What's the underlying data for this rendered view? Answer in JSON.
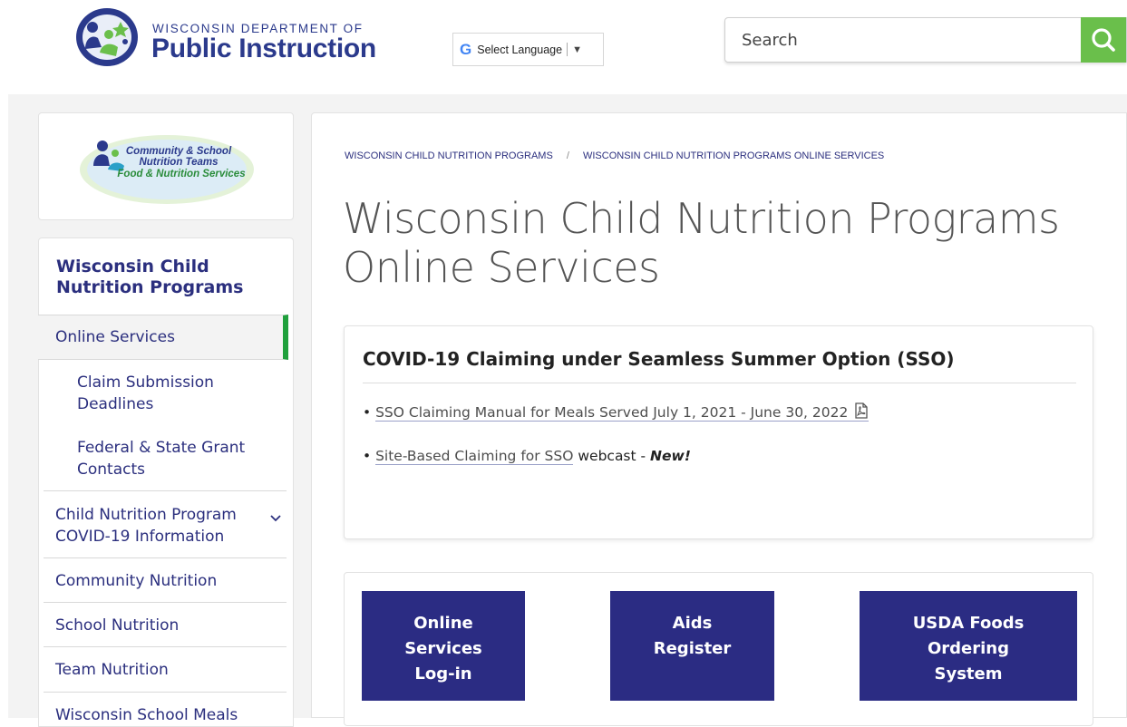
{
  "header": {
    "logo_top": "WISCONSIN DEPARTMENT OF",
    "logo_main": "Public Instruction",
    "translate_label": "Select Language",
    "search_placeholder": "Search"
  },
  "sidebar": {
    "logo_text": [
      "Community & School",
      "Nutrition Teams",
      "Food & Nutrition Services"
    ],
    "title": "Wisconsin Child Nutrition Programs",
    "items": [
      {
        "label": "Online Services"
      },
      {
        "label": "Claim Submission Deadlines"
      },
      {
        "label": "Federal & State Grant Contacts"
      },
      {
        "label": "Child Nutrition Program COVID-19 Information"
      },
      {
        "label": "Community Nutrition"
      },
      {
        "label": "School Nutrition"
      },
      {
        "label": "Team Nutrition"
      },
      {
        "label": "Wisconsin School Meals"
      }
    ]
  },
  "breadcrumb": {
    "items": [
      "WISCONSIN CHILD NUTRITION PROGRAMS",
      "WISCONSIN CHILD NUTRITION PROGRAMS ONLINE SERVICES"
    ],
    "separator": "/"
  },
  "main": {
    "title": "Wisconsin Child Nutrition Programs Online Services",
    "covid": {
      "heading": "COVID-19 Claiming under Seamless Summer Option (SSO)",
      "item1_link": "SSO Claiming Manual for Meals Served July 1, 2021 - June 30, 2022",
      "item2_link": "Site-Based Claiming for SSO",
      "item2_suffix": " webcast - ",
      "item2_new": "New!"
    },
    "buttons": [
      {
        "label_lines": [
          "Online",
          "Services",
          "Log-in"
        ]
      },
      {
        "label_lines": [
          "Aids",
          "Register"
        ]
      },
      {
        "label_lines": [
          "USDA Foods",
          "Ordering",
          "System"
        ]
      }
    ]
  },
  "colors": {
    "brand_navy": "#2b2c83",
    "accent_green": "#6abf4b",
    "active_indicator": "#1fa03c"
  }
}
